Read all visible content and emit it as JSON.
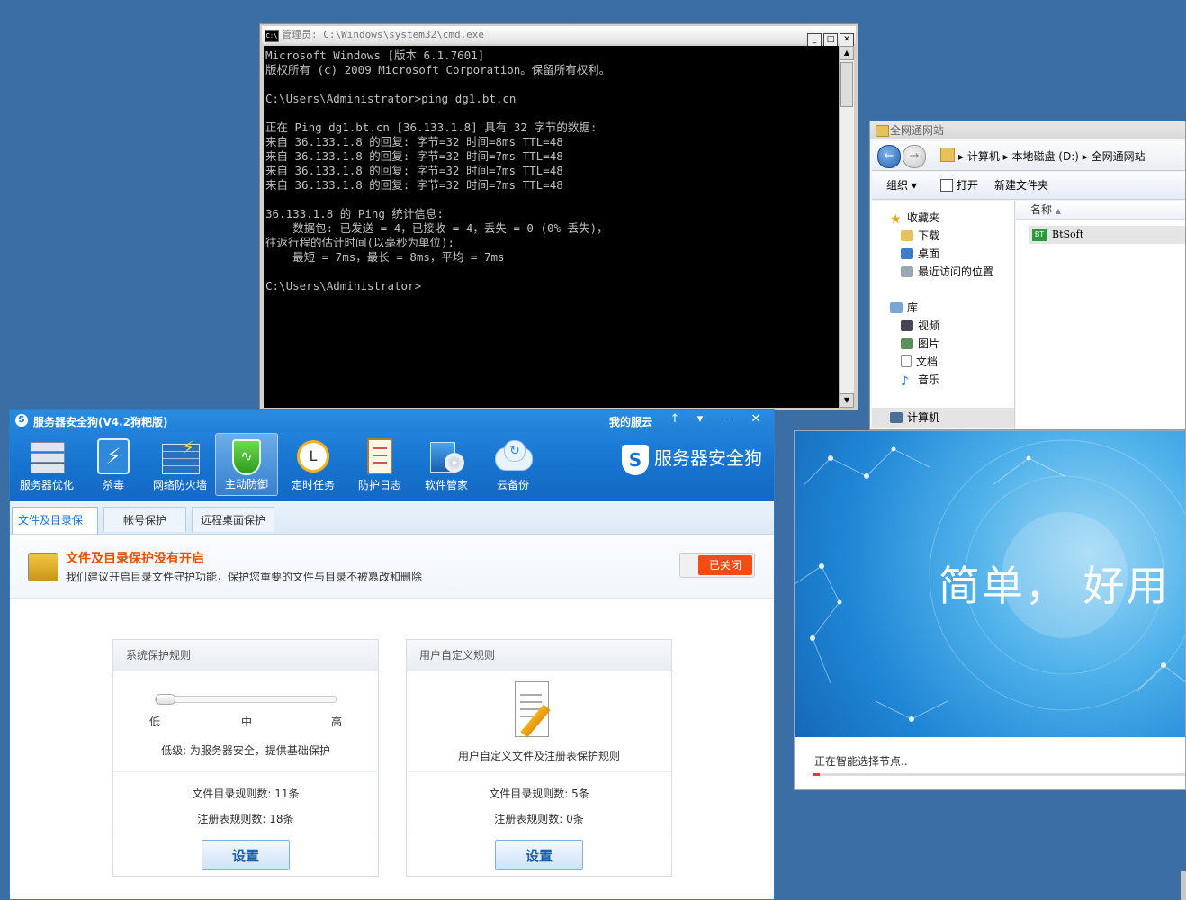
{
  "cmd": {
    "title": "管理员: C:\\Windows\\system32\\cmd.exe",
    "icon_label": "C:\\",
    "buttons": [
      "_",
      "□",
      "✕"
    ],
    "lines": [
      "Microsoft Windows [版本 6.1.7601]",
      "版权所有 (c) 2009 Microsoft Corporation。保留所有权利。",
      "",
      "C:\\Users\\Administrator>ping dg1.bt.cn",
      "",
      "正在 Ping dg1.bt.cn [36.133.1.8] 具有 32 字节的数据:",
      "来自 36.133.1.8 的回复: 字节=32 时间=8ms TTL=48",
      "来自 36.133.1.8 的回复: 字节=32 时间=7ms TTL=48",
      "来自 36.133.1.8 的回复: 字节=32 时间=7ms TTL=48",
      "来自 36.133.1.8 的回复: 字节=32 时间=7ms TTL=48",
      "",
      "36.133.1.8 的 Ping 统计信息:",
      "    数据包: 已发送 = 4，已接收 = 4，丢失 = 0 (0% 丢失)，",
      "往返行程的估计时间(以毫秒为单位):",
      "    最短 = 7ms，最长 = 8ms，平均 = 7ms",
      "",
      "C:\\Users\\Administrator>"
    ]
  },
  "explorer": {
    "title": "全网通网站",
    "breadcrumb": "▸ 计算机 ▸ 本地磁盘 (D:) ▸ 全网通网站",
    "toolbar": {
      "organize": "组织 ▾",
      "open": "打开",
      "new_folder": "新建文件夹"
    },
    "nav": {
      "favorites": "收藏夹",
      "downloads": "下载",
      "desktop": "桌面",
      "recent": "最近访问的位置",
      "libraries": "库",
      "videos": "视频",
      "pictures": "图片",
      "documents": "文档",
      "music": "音乐",
      "computer": "计算机"
    },
    "column_name": "名称",
    "file_icon": "BT",
    "file": "BtSoft"
  },
  "splash": {
    "slogan": "简单，  好用",
    "status": "正在智能选择节点..",
    "progress": 0.02
  },
  "dog": {
    "title": "服务器安全狗(V4.2狗粑版)",
    "logo_letter": "S",
    "my_cloud": "我的服云",
    "window_buttons": [
      "↑",
      "▾",
      "—",
      "✕"
    ],
    "brand": "服务器安全狗",
    "tools": [
      {
        "label": "服务器优化"
      },
      {
        "label": "杀毒"
      },
      {
        "label": "网络防火墙"
      },
      {
        "label": "主动防御"
      },
      {
        "label": "定时任务"
      },
      {
        "label": "防护日志"
      },
      {
        "label": "软件管家"
      },
      {
        "label": "云备份"
      }
    ],
    "tabs": [
      "文件及目录保护",
      "帐号保护",
      "远程桌面保护"
    ],
    "notice": {
      "title": "文件及目录保护没有开启",
      "desc": "我们建议开启目录文件守护功能，保护您重要的文件与目录不被篡改和删除",
      "switch_label": "已关闭"
    },
    "system_panel": {
      "header": "系统保护规则",
      "levels": [
        "低",
        "中",
        "高"
      ],
      "level_value": 0,
      "level_desc": "低级: 为服务器安全，提供基础保护",
      "file_rules": "文件目录规则数: 11条",
      "reg_rules": "注册表规则数: 18条",
      "button": "设置"
    },
    "custom_panel": {
      "header": "用户自定义规则",
      "desc": "用户自定义文件及注册表保护规则",
      "file_rules": "文件目录规则数: 5条",
      "reg_rules": "注册表规则数: 0条",
      "button": "设置"
    }
  }
}
